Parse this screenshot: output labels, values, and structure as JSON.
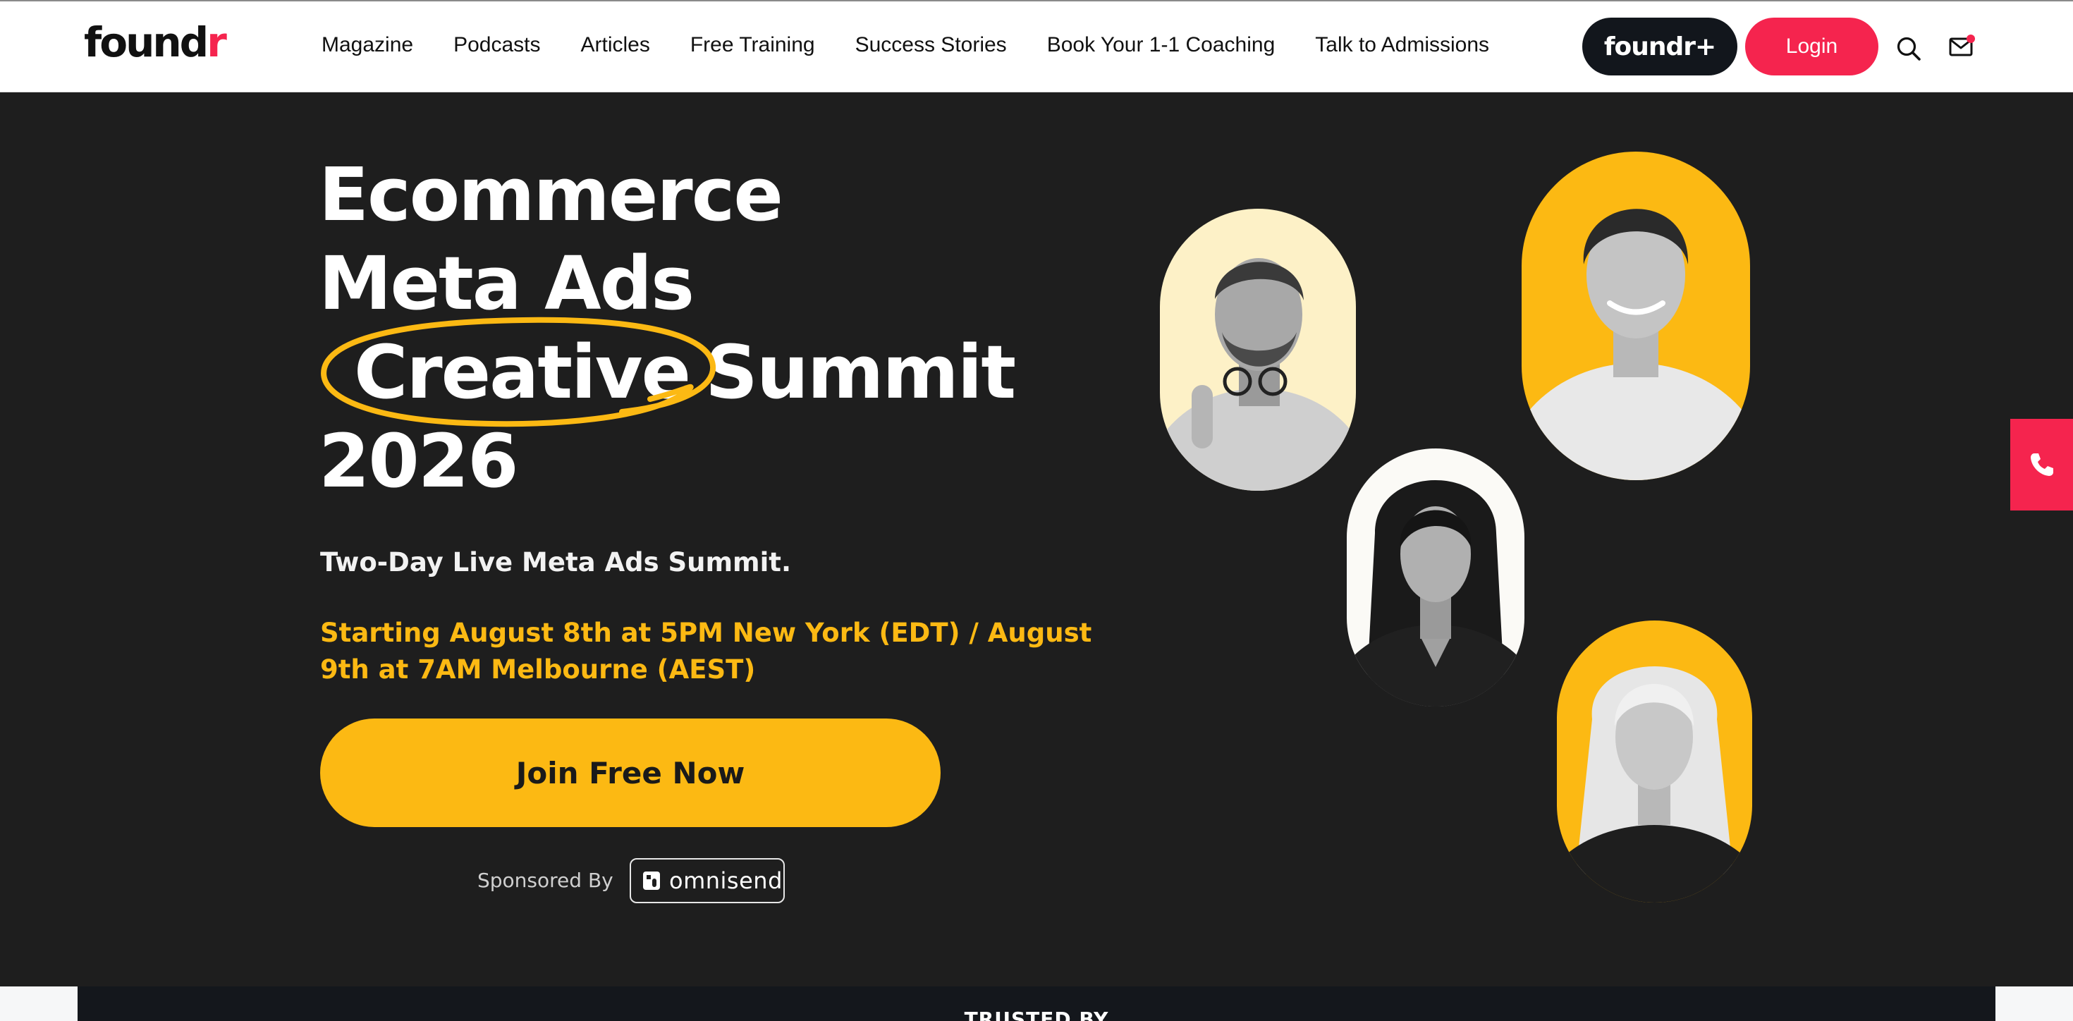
{
  "header": {
    "logo": {
      "text_main": "found",
      "text_accent": "r"
    },
    "nav": [
      {
        "label": "Magazine"
      },
      {
        "label": "Podcasts"
      },
      {
        "label": "Articles"
      },
      {
        "label": "Free Training"
      },
      {
        "label": "Success Stories"
      },
      {
        "label": "Book Your 1-1 Coaching"
      },
      {
        "label": "Talk to Admissions"
      }
    ],
    "foundr_plus_label": "foundr+",
    "login_label": "Login",
    "search_icon": "search-icon",
    "mail_icon": "mail-icon"
  },
  "hero": {
    "title_line1": "Ecommerce",
    "title_line2": "Meta Ads",
    "title_highlight": "Creative",
    "title_line3_rest": "Summit",
    "title_line4": "2026",
    "subtitle": "Two-Day Live Meta Ads Summit.",
    "date_text": "Starting August 8th at 5PM New York (EDT) / August 9th at 7AM Melbourne (AEST)",
    "cta_label": "Join Free Now",
    "sponsored_label": "Sponsored By",
    "sponsor_name": "omnisend"
  },
  "side_contact_icon": "phone-icon",
  "trusted_label": "TRUSTED BY",
  "colors": {
    "accent_pink": "#f5244e",
    "accent_yellow": "#fcb913",
    "hero_bg": "#1e1e1e",
    "dark_button": "#12161c"
  }
}
